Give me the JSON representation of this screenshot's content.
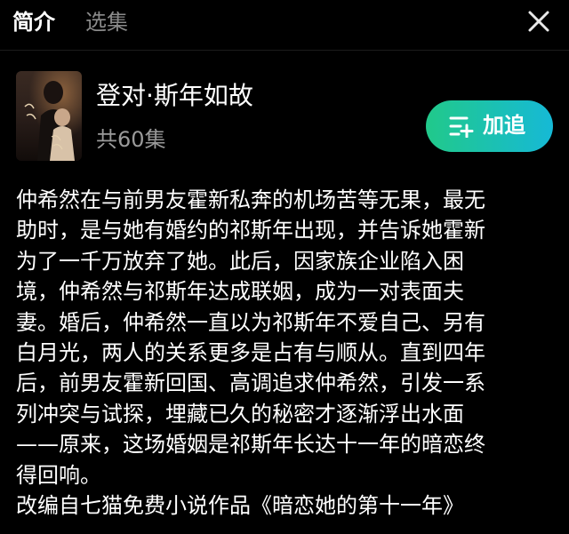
{
  "tabs": [
    {
      "label": "简介",
      "active": true
    },
    {
      "label": "选集",
      "active": false
    }
  ],
  "close_icon": "close-icon",
  "show": {
    "title": "登对·斯年如故",
    "episodes": "共60集",
    "poster_text": "登对 斯年"
  },
  "follow_button": {
    "label": "加追",
    "icon": "add-list-icon"
  },
  "synopsis_lines": [
    "仲希然在与前男友霍新私奔的机场苦等无果，最无",
    "助时，是与她有婚约的祁斯年出现，并告诉她霍新",
    "为了一千万放弃了她。此后，因家族企业陷入困",
    "境，仲希然与祁斯年达成联姻，成为一对表面夫",
    "妻。婚后，仲希然一直以为祁斯年不爱自己、另有",
    "白月光，两人的关系更多是占有与顺从。直到四年",
    "后，前男友霍新回国、高调追求仲希然，引发一系",
    "列冲突与试探，埋藏已久的秘密才逐渐浮出水面",
    "——原来，这场婚姻是祁斯年长达十一年的暗恋终",
    "得回响。",
    "改编自七猫免费小说作品《暗恋她的第十一年》"
  ],
  "colors": {
    "background": "#000000",
    "inactive_tab": "#8a8a8a",
    "secondary_text": "#9a9a9a",
    "accent_start": "#21c98a",
    "accent_end": "#16b9d6"
  }
}
